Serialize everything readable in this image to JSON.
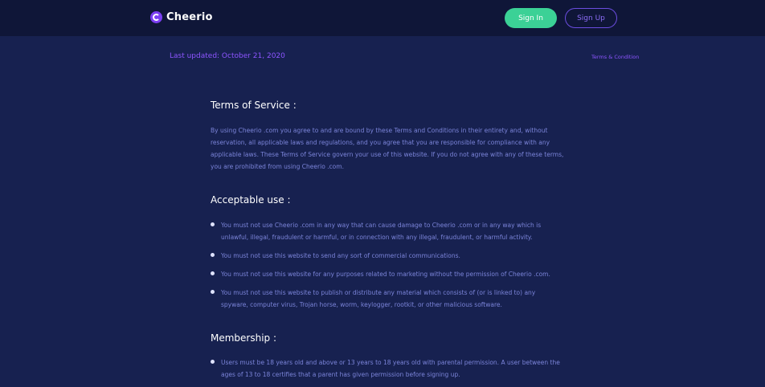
{
  "header": {
    "brand": "Cheerio",
    "sign_in": "Sign In",
    "sign_up": "Sign Up"
  },
  "meta": {
    "last_updated": "Last updated: October 21, 2020",
    "breadcrumb": "Terms & Condition"
  },
  "sections": {
    "tos": {
      "title": "Terms of Service :",
      "text": "By using Cheerio .com you agree to and are bound by these Terms and Conditions in their entirety and, without reservation, all applicable laws and regulations, and you agree that you are responsible for compliance with any applicable laws. These Terms of Service govern your use of this website. If you do not agree with any of these terms, you are prohibited from using Cheerio .com."
    },
    "acceptable": {
      "title": "Acceptable use :",
      "items": [
        "You must not use Cheerio .com in any way that can cause damage to Cheerio .com or in any way which is unlawful, illegal, fraudulent or harmful, or in connection with any illegal, fraudulent, or harmful activity.",
        "You must not use this website to send any sort of commercial communications.",
        "You must not use this website for any purposes related to marketing without the permission of Cheerio .com.",
        "You must not use this website to publish or distribute any material which consists of (or is linked to) any spyware, computer virus, Trojan horse, worm, keylogger, rootkit, or other malicious software."
      ]
    },
    "membership": {
      "title": "Membership :",
      "items": [
        "Users must be 18 years old and above or 13 years to 18 years old with parental permission. A user between the ages of 13 to 18 certifies that a parent has given permission before signing up."
      ]
    }
  },
  "colors": {
    "background": "#172150",
    "topbar": "#0f1638",
    "accent_purple": "#8d55ff",
    "accent_green": "#3bd196",
    "body_text": "#7b84d9"
  }
}
